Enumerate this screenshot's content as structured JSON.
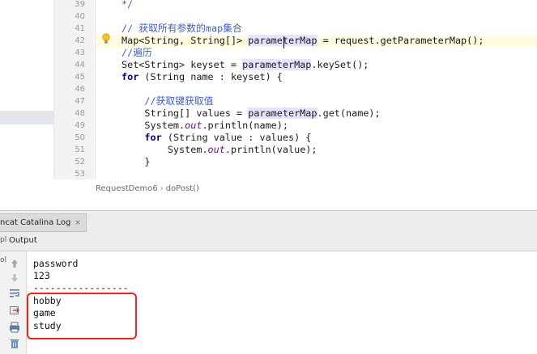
{
  "editor": {
    "line_numbers": [
      "39",
      "40",
      "41",
      "42",
      "43",
      "44",
      "45",
      "46",
      "47",
      "48",
      "49",
      "50",
      "51",
      "52",
      "53"
    ],
    "lines": [
      {
        "segments": [
          {
            "t": "*/",
            "c": "cm"
          }
        ]
      },
      {
        "segments": []
      },
      {
        "segments": [
          {
            "t": "// 获取所有参数的map集合",
            "c": "cm"
          }
        ]
      },
      {
        "segments": [
          {
            "t": "Map<String, String[]> "
          },
          {
            "t": "parameterMap",
            "c": "hl"
          },
          {
            "t": " = request.getParameterMap();"
          }
        ]
      },
      {
        "segments": [
          {
            "t": "//遍历",
            "c": "cm"
          }
        ]
      },
      {
        "segments": [
          {
            "t": "Set<String> keyset = "
          },
          {
            "t": "parameterMap",
            "c": "hl"
          },
          {
            "t": ".keySet();"
          }
        ]
      },
      {
        "segments": [
          {
            "t": "for",
            "c": "kw"
          },
          {
            "t": " (String name : keyset) {"
          }
        ]
      },
      {
        "segments": []
      },
      {
        "segments": [
          {
            "t": "    "
          },
          {
            "t": "//获取键获取值",
            "c": "cm"
          }
        ]
      },
      {
        "segments": [
          {
            "t": "    String[] values = "
          },
          {
            "t": "parameterMap",
            "c": "hl"
          },
          {
            "t": ".get(name);"
          }
        ]
      },
      {
        "segments": [
          {
            "t": "    System."
          },
          {
            "t": "out",
            "c": "ital"
          },
          {
            "t": ".println(name);"
          }
        ]
      },
      {
        "segments": [
          {
            "t": "    "
          },
          {
            "t": "for",
            "c": "kw"
          },
          {
            "t": " (String value : values) {"
          }
        ]
      },
      {
        "segments": [
          {
            "t": "        System."
          },
          {
            "t": "out",
            "c": "ital"
          },
          {
            "t": ".println(value);"
          }
        ]
      },
      {
        "segments": [
          {
            "t": "    }"
          }
        ]
      },
      {
        "segments": []
      }
    ],
    "breadcrumb": {
      "class_name": "RequestDemo6",
      "separator": "›",
      "method": "doPost()"
    }
  },
  "tabs": {
    "catalina_log": "ncat Catalina Log",
    "close_glyph": "×"
  },
  "output": {
    "side_label": "ol",
    "header_side_label": "pl",
    "title": "Output",
    "lines": [
      "password",
      "123",
      "-----------------",
      "hobby",
      "game",
      "study"
    ]
  },
  "colors": {
    "highlight_box": "#e8261f",
    "comment": "#3f5fbf",
    "keyword": "#000080"
  }
}
